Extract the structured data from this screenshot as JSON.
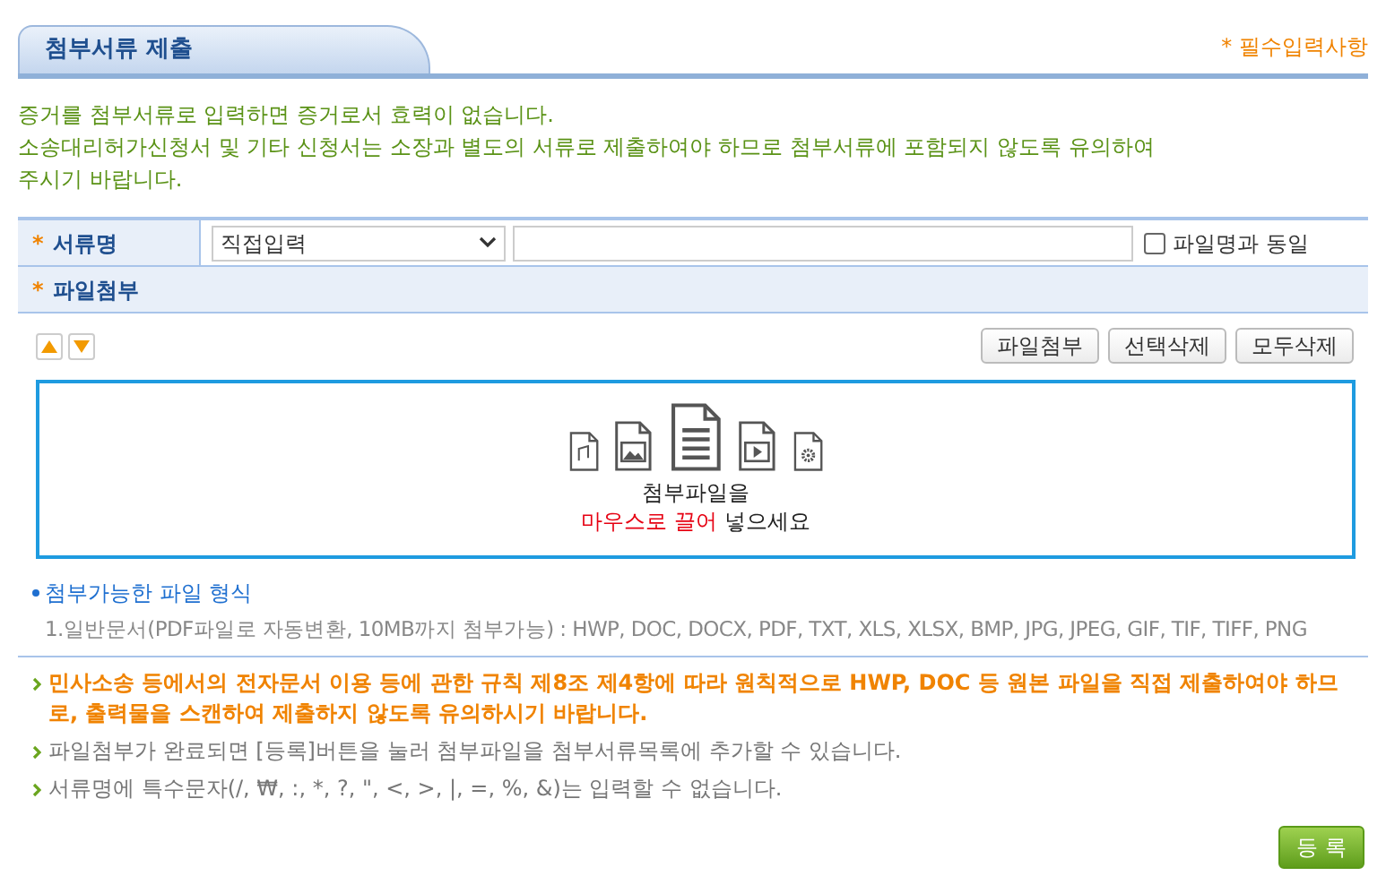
{
  "header": {
    "tab_title": "첨부서류 제출",
    "required_note": "* 필수입력사항"
  },
  "intro": [
    "증거를 첨부서류로 입력하면 증거로서 효력이 없습니다.",
    "소송대리허가신청서 및 기타 신청서는 소장과 별도의 서류로 제출하여야 하므로 첨부서류에 포함되지 않도록 유의하여",
    "주시기 바랍니다."
  ],
  "form": {
    "doc_name_label": "서류명",
    "required_mark": "*",
    "select_value": "직접입력",
    "same_as_filename": {
      "label": "파일명과 동일",
      "checked": false
    },
    "attach_label": "파일첨부"
  },
  "toolbar": {
    "buttons": [
      "파일첨부",
      "선택삭제",
      "모두삭제"
    ]
  },
  "dropzone": {
    "line1": "첨부파일을",
    "line2": [
      {
        "text": "마우스로 끌어",
        "highlight": true
      },
      {
        "text": " 넣으세요",
        "highlight": false
      }
    ]
  },
  "formats": {
    "title": "첨부가능한 파일 형식",
    "items": [
      "1.일반문서(PDF파일로 자동변환, 10MB까지 첨부가능) : HWP, DOC, DOCX, PDF, TXT, XLS, XLSX, BMP, JPG, JPEG, GIF, TIF, TIFF, PNG"
    ]
  },
  "notes": [
    {
      "kind": "warning",
      "text": "민사소송 등에서의 전자문서 이용 등에 관한 규칙 제8조 제4항에 따라 원칙적으로 HWP, DOC 등 원본 파일을 직접 제출하여야 하므로, 출력물을 스캔하여 제출하지 않도록 유의하시기 바랍니다."
    },
    {
      "kind": "info",
      "text": "파일첨부가 완료되면 [등록]버튼을 눌러 첨부파일을 첨부서류목록에 추가할 수 있습니다."
    },
    {
      "kind": "info",
      "text": "서류명에 특수문자(/, ₩, :, *, ?, \", <, >, |, =, %, &)는 입력할 수 없습니다."
    }
  ],
  "submit_button": "등 록"
}
